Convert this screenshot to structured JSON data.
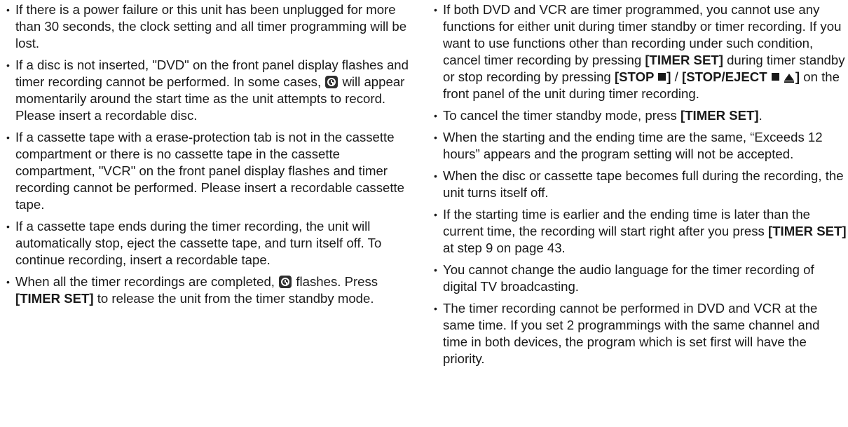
{
  "left_notes": [
    {
      "text": "If there is a power failure or this unit has been unplugged for more than 30 seconds, the clock setting and all timer programming will be lost."
    },
    {
      "pre": "If a disc is not inserted, \"DVD\" on the front panel display flashes and timer recording cannot be performed. In some cases,",
      "icon": "timer-clock-icon",
      "post": "will appear momentarily around the start time as the unit attempts to record. Please insert a recordable disc."
    },
    {
      "text": "If a cassette tape with a erase-protection tab is not in the cassette compartment or there is no cassette tape in the cassette compartment, \"VCR\" on the front panel display flashes and timer recording cannot be performed. Please insert a recordable cassette tape."
    },
    {
      "text": "If a cassette tape ends during the timer recording, the unit will automatically stop, eject the cassette tape, and turn itself off. To continue recording, insert a recordable tape."
    },
    {
      "pre": "When all the timer recordings are completed,",
      "icon": "timer-clock-icon",
      "mid": "flashes. Press",
      "bold": "[TIMER SET]",
      "post": "to release the unit from the timer standby mode."
    }
  ],
  "right_notes": [
    {
      "pre": "If both DVD and VCR are timer programmed, you cannot use any functions for either unit during timer standby or timer recording. If you want to use functions other than recording under such condition, cancel timer recording by pressing",
      "bold1": "[TIMER SET]",
      "mid1": "during timer standby or stop recording by pressing",
      "bold2a": "[STOP",
      "bold2b": "]",
      "slash": "/",
      "bold3a": "[STOP/EJECT",
      "bold3b": "]",
      "post": "on the front panel of the unit during timer recording."
    },
    {
      "pre": "To cancel the timer standby mode, press",
      "bold": "[TIMER SET]",
      "post": "."
    },
    {
      "text": "When the starting and the ending time are the same, “Exceeds 12 hours” appears and the program setting will not be accepted."
    },
    {
      "text": "When the disc or cassette tape becomes full during the recording, the unit turns itself off."
    },
    {
      "pre": "If the starting time is earlier and the ending time is later than the current time, the recording will start right after you press",
      "bold": "[TIMER SET]",
      "post": "at step 9 on page 43."
    },
    {
      "text": "You cannot change the audio language for the timer recording of digital TV broadcasting."
    },
    {
      "text": "The timer recording cannot be performed in DVD and VCR at the same time. If you set 2 programmings with the same channel and time in both devices, the program which is set first will have the priority."
    }
  ]
}
